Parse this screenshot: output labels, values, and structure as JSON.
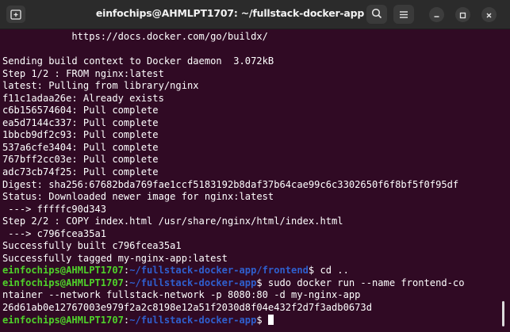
{
  "window": {
    "title": "einfochips@AHMLPT1707: ~/fullstack-docker-app"
  },
  "toolbar": {
    "new_tab_icon": "terminal-plus-icon",
    "search_icon": "search-icon",
    "menu_icon": "hamburger-menu-icon",
    "minimize_icon": "minimize-icon",
    "maximize_icon": "maximize-icon",
    "close_icon": "close-icon"
  },
  "colors": {
    "background": "#300a24",
    "titlebar": "#2b2b2b",
    "prompt_user": "#4fd22a",
    "prompt_path": "#2f5fce",
    "text": "#ffffff"
  },
  "terminal": {
    "lines": [
      {
        "text": "            https://docs.docker.com/go/buildx/"
      },
      {
        "text": ""
      },
      {
        "text": "Sending build context to Docker daemon  3.072kB"
      },
      {
        "text": "Step 1/2 : FROM nginx:latest"
      },
      {
        "text": "latest: Pulling from library/nginx"
      },
      {
        "text": "f11c1adaa26e: Already exists"
      },
      {
        "text": "c6b156574604: Pull complete"
      },
      {
        "text": "ea5d7144c337: Pull complete"
      },
      {
        "text": "1bbcb9df2c93: Pull complete"
      },
      {
        "text": "537a6cfe3404: Pull complete"
      },
      {
        "text": "767bff2cc03e: Pull complete"
      },
      {
        "text": "adc73cb74f25: Pull complete"
      },
      {
        "text": "Digest: sha256:67682bda769fae1ccf5183192b8daf37b64cae99c6c3302650f6f8bf5f0f95df"
      },
      {
        "text": "Status: Downloaded newer image for nginx:latest"
      },
      {
        "text": " ---> fffffc90d343"
      },
      {
        "text": "Step 2/2 : COPY index.html /usr/share/nginx/html/index.html"
      },
      {
        "text": " ---> c796fcea35a1"
      },
      {
        "text": "Successfully built c796fcea35a1"
      },
      {
        "text": "Successfully tagged my-nginx-app:latest"
      },
      {
        "user": "einfochips@AHMLPT1707",
        "sep": ":",
        "path": "~/fullstack-docker-app/frontend",
        "cmd": "$ cd .."
      },
      {
        "user": "einfochips@AHMLPT1707",
        "sep": ":",
        "path": "~/fullstack-docker-app",
        "cmd": "$ sudo docker run --name frontend-co"
      },
      {
        "text": "ntainer --network fullstack-network -p 8080:80 -d my-nginx-app"
      },
      {
        "text": "26d61ab0e12767003e979f2a2c8198e12a51f2030d8f04e432f2d7f3adb0673d"
      },
      {
        "user": "einfochips@AHMLPT1707",
        "sep": ":",
        "path": "~/fullstack-docker-app",
        "cmd": "$ ",
        "cursor": true
      }
    ]
  }
}
